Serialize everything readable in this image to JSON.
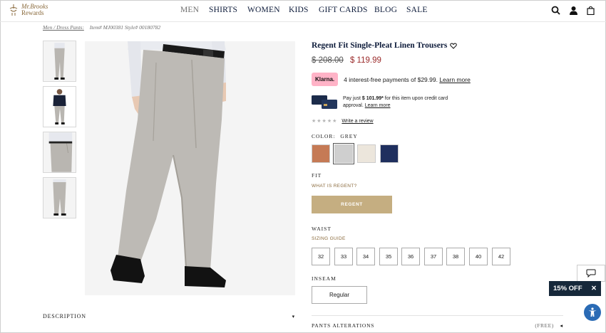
{
  "header": {
    "logo": {
      "line1": "Mr.Brooks",
      "line2": "Rewards"
    },
    "nav": [
      "MEN",
      "SHIRTS",
      "WOMEN",
      "KIDS",
      "GIFT CARDS",
      "BLOG",
      "SALE"
    ]
  },
  "breadcrumb": {
    "path": "Men / Dress Pants:",
    "item": "Item# MJ00381 Style# 00180782"
  },
  "product": {
    "title": "Regent Fit Single-Pleat Linen Trousers",
    "price_old": "$ 208.00",
    "price_new": "$ 119.99",
    "klarna": {
      "badge": "Klarna.",
      "text": "4 interest-free payments of $29.99.",
      "link": "Learn more"
    },
    "card_offer": {
      "pre": "Pay just ",
      "amount": "$ 101.99*",
      "post": " for this item upon credit card approval.",
      "link": "Learn more"
    },
    "stars": "★★★★★",
    "review_link": "Write a review",
    "color_label": "COLOR:",
    "color_value": "GREY",
    "swatches": [
      "#c57a55",
      "#cfcfcf",
      "#ece6dc",
      "#1f2f5e"
    ],
    "fit_label": "FIT",
    "fit_link": "WHAT IS REGENT?",
    "fit_button": "REGENT",
    "waist_label": "WAIST",
    "sizing_link": "SIZING GUIDE",
    "waist_sizes": [
      "32",
      "33",
      "34",
      "35",
      "36",
      "37",
      "38",
      "40",
      "42"
    ],
    "inseam_label": "INSEAM",
    "inseam_button": "Regular",
    "alterations": {
      "label": "PANTS ALTERATIONS",
      "free": "(FREE)",
      "arrow": "◂"
    },
    "description_label": "DESCRIPTION",
    "description_arrow": "▾"
  },
  "widgets": {
    "promo": "15% OFF",
    "promo_close": "✕"
  },
  "colors": {
    "navy": "#0d1b3a",
    "gold": "#c5ae81",
    "sale_red": "#9b2b2b",
    "promo_bg": "#16283a",
    "klarna_pink": "#ffb3c7"
  }
}
